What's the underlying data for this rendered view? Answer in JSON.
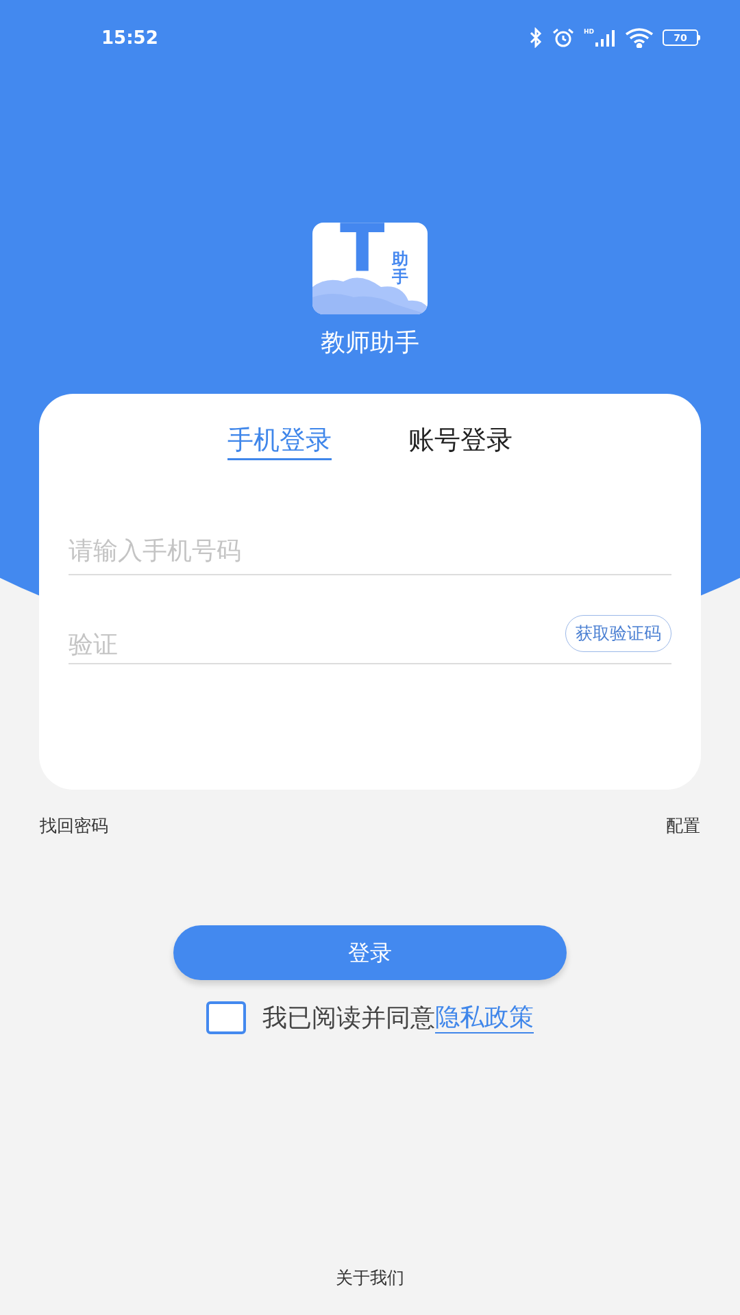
{
  "status_bar": {
    "time": "15:52",
    "network": "HD",
    "battery": "70"
  },
  "app": {
    "logo_letter": "T",
    "logo_caption": "助手",
    "name": "教师助手"
  },
  "tabs": [
    {
      "label": "手机登录",
      "selected": true
    },
    {
      "label": "账号登录",
      "selected": false
    }
  ],
  "phone_field": {
    "placeholder": "请输入手机号码"
  },
  "code_field": {
    "placeholder": "验证",
    "button": "获取验证码"
  },
  "links": {
    "left": "找回密码",
    "right": "配置"
  },
  "login_button": "登录",
  "agreement": {
    "checked": false,
    "text": "我已阅读并同意",
    "link": "隐私政策"
  },
  "footer": "关于我们"
}
